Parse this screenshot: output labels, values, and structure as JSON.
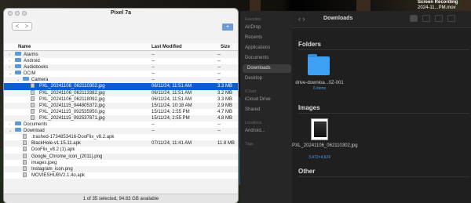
{
  "desktop": {
    "recording": {
      "line1": "Screen Recording",
      "line2": "2024-11...PM.mov"
    }
  },
  "transfer": {
    "title": "Pixel 7a",
    "nav": {
      "back": "<",
      "forward": ">"
    },
    "headers": {
      "name": "Name",
      "modified": "Last Modified",
      "size": "Size"
    },
    "rows": [
      {
        "level": 0,
        "type": "folder",
        "expand": "›",
        "name": "Alarms",
        "modified": "--",
        "size": "--"
      },
      {
        "level": 0,
        "type": "folder",
        "expand": "›",
        "name": "Android",
        "modified": "--",
        "size": "--"
      },
      {
        "level": 0,
        "type": "folder",
        "expand": "›",
        "name": "Audiobooks",
        "modified": "--",
        "size": "--"
      },
      {
        "level": 0,
        "type": "folder",
        "expand": "⌄",
        "name": "DCIM",
        "modified": "--",
        "size": "--"
      },
      {
        "level": 1,
        "type": "folder",
        "expand": "⌄",
        "name": "Camera",
        "modified": "--",
        "size": "--"
      },
      {
        "level": 2,
        "type": "file",
        "name": "PXL_20241106_062110302.jpg",
        "modified": "06/11/24, 11:51 AM",
        "size": "3.3 MB",
        "selected": true
      },
      {
        "level": 2,
        "type": "file",
        "name": "PXL_20241106_062113382.jpg",
        "modified": "06/11/24, 11:51 AM",
        "size": "3.2 MB"
      },
      {
        "level": 2,
        "type": "file",
        "name": "PXL_20241106_062118092.jpg",
        "modified": "06/11/24, 11:51 AM",
        "size": "3.3 MB"
      },
      {
        "level": 2,
        "type": "file",
        "name": "PXL_20241115_044805372.jpg",
        "modified": "15/11/24, 10:18 AM",
        "size": "2.9 MB"
      },
      {
        "level": 2,
        "type": "file",
        "name": "PXL_20241115_092535950.jpg",
        "modified": "15/11/24, 2:55 PM",
        "size": "4.7 MB"
      },
      {
        "level": 2,
        "type": "file",
        "name": "PXL_20241115_092537871.jpg",
        "modified": "15/11/24, 2:55 PM",
        "size": "4.8 MB"
      },
      {
        "level": 0,
        "type": "folder",
        "expand": "›",
        "name": "Documents",
        "modified": "--",
        "size": "--"
      },
      {
        "level": 0,
        "type": "folder",
        "expand": "⌄",
        "name": "Download",
        "modified": "--",
        "size": "--"
      },
      {
        "level": 1,
        "type": "file",
        "name": ".trashed-1734853416-DooFlix_v8.2.apk",
        "modified": "",
        "size": ""
      },
      {
        "level": 1,
        "type": "file",
        "name": "BlackHole-v1.15.11.apk",
        "modified": "07/11/24, 11:41 AM",
        "size": "11.8 MB"
      },
      {
        "level": 1,
        "type": "file",
        "name": "DooFlix_v8.2 (1).apk",
        "modified": "",
        "size": ""
      },
      {
        "level": 1,
        "type": "file",
        "name": "Google_Chrome_icon_(2011).png",
        "modified": "",
        "size": ""
      },
      {
        "level": 1,
        "type": "file",
        "name": "images.jpeg",
        "modified": "",
        "size": ""
      },
      {
        "level": 1,
        "type": "file",
        "name": "Instagram_icon.png",
        "modified": "",
        "size": ""
      },
      {
        "level": 1,
        "type": "file",
        "name": "MOVIESHUBV2.1.4o.apk",
        "modified": "",
        "size": ""
      }
    ],
    "status": "1 of 35 selected, 94.63 GB available"
  },
  "finder": {
    "title": "Downloads",
    "sidebar": [
      {
        "label": "Favorites",
        "kind": "section"
      },
      {
        "label": "AirDrop"
      },
      {
        "label": "Recents"
      },
      {
        "label": "Applications"
      },
      {
        "label": "Documents"
      },
      {
        "label": "Downloads",
        "selected": true
      },
      {
        "label": "Desktop"
      },
      {
        "label": "iCloud",
        "kind": "section"
      },
      {
        "label": "iCloud Drive"
      },
      {
        "label": "Shared"
      },
      {
        "label": "Locations",
        "kind": "section"
      },
      {
        "label": "Android..."
      },
      {
        "label": "Tags",
        "kind": "section"
      }
    ],
    "sections": {
      "folders": "Folders",
      "images": "Images",
      "other": "Other"
    },
    "folder_item": {
      "name": "drive-downloa...0Z-001",
      "sub": "6 items"
    },
    "image_item": {
      "name": "PXL_20241106_062110302.jpg",
      "sub": "3,472×4,624"
    }
  }
}
